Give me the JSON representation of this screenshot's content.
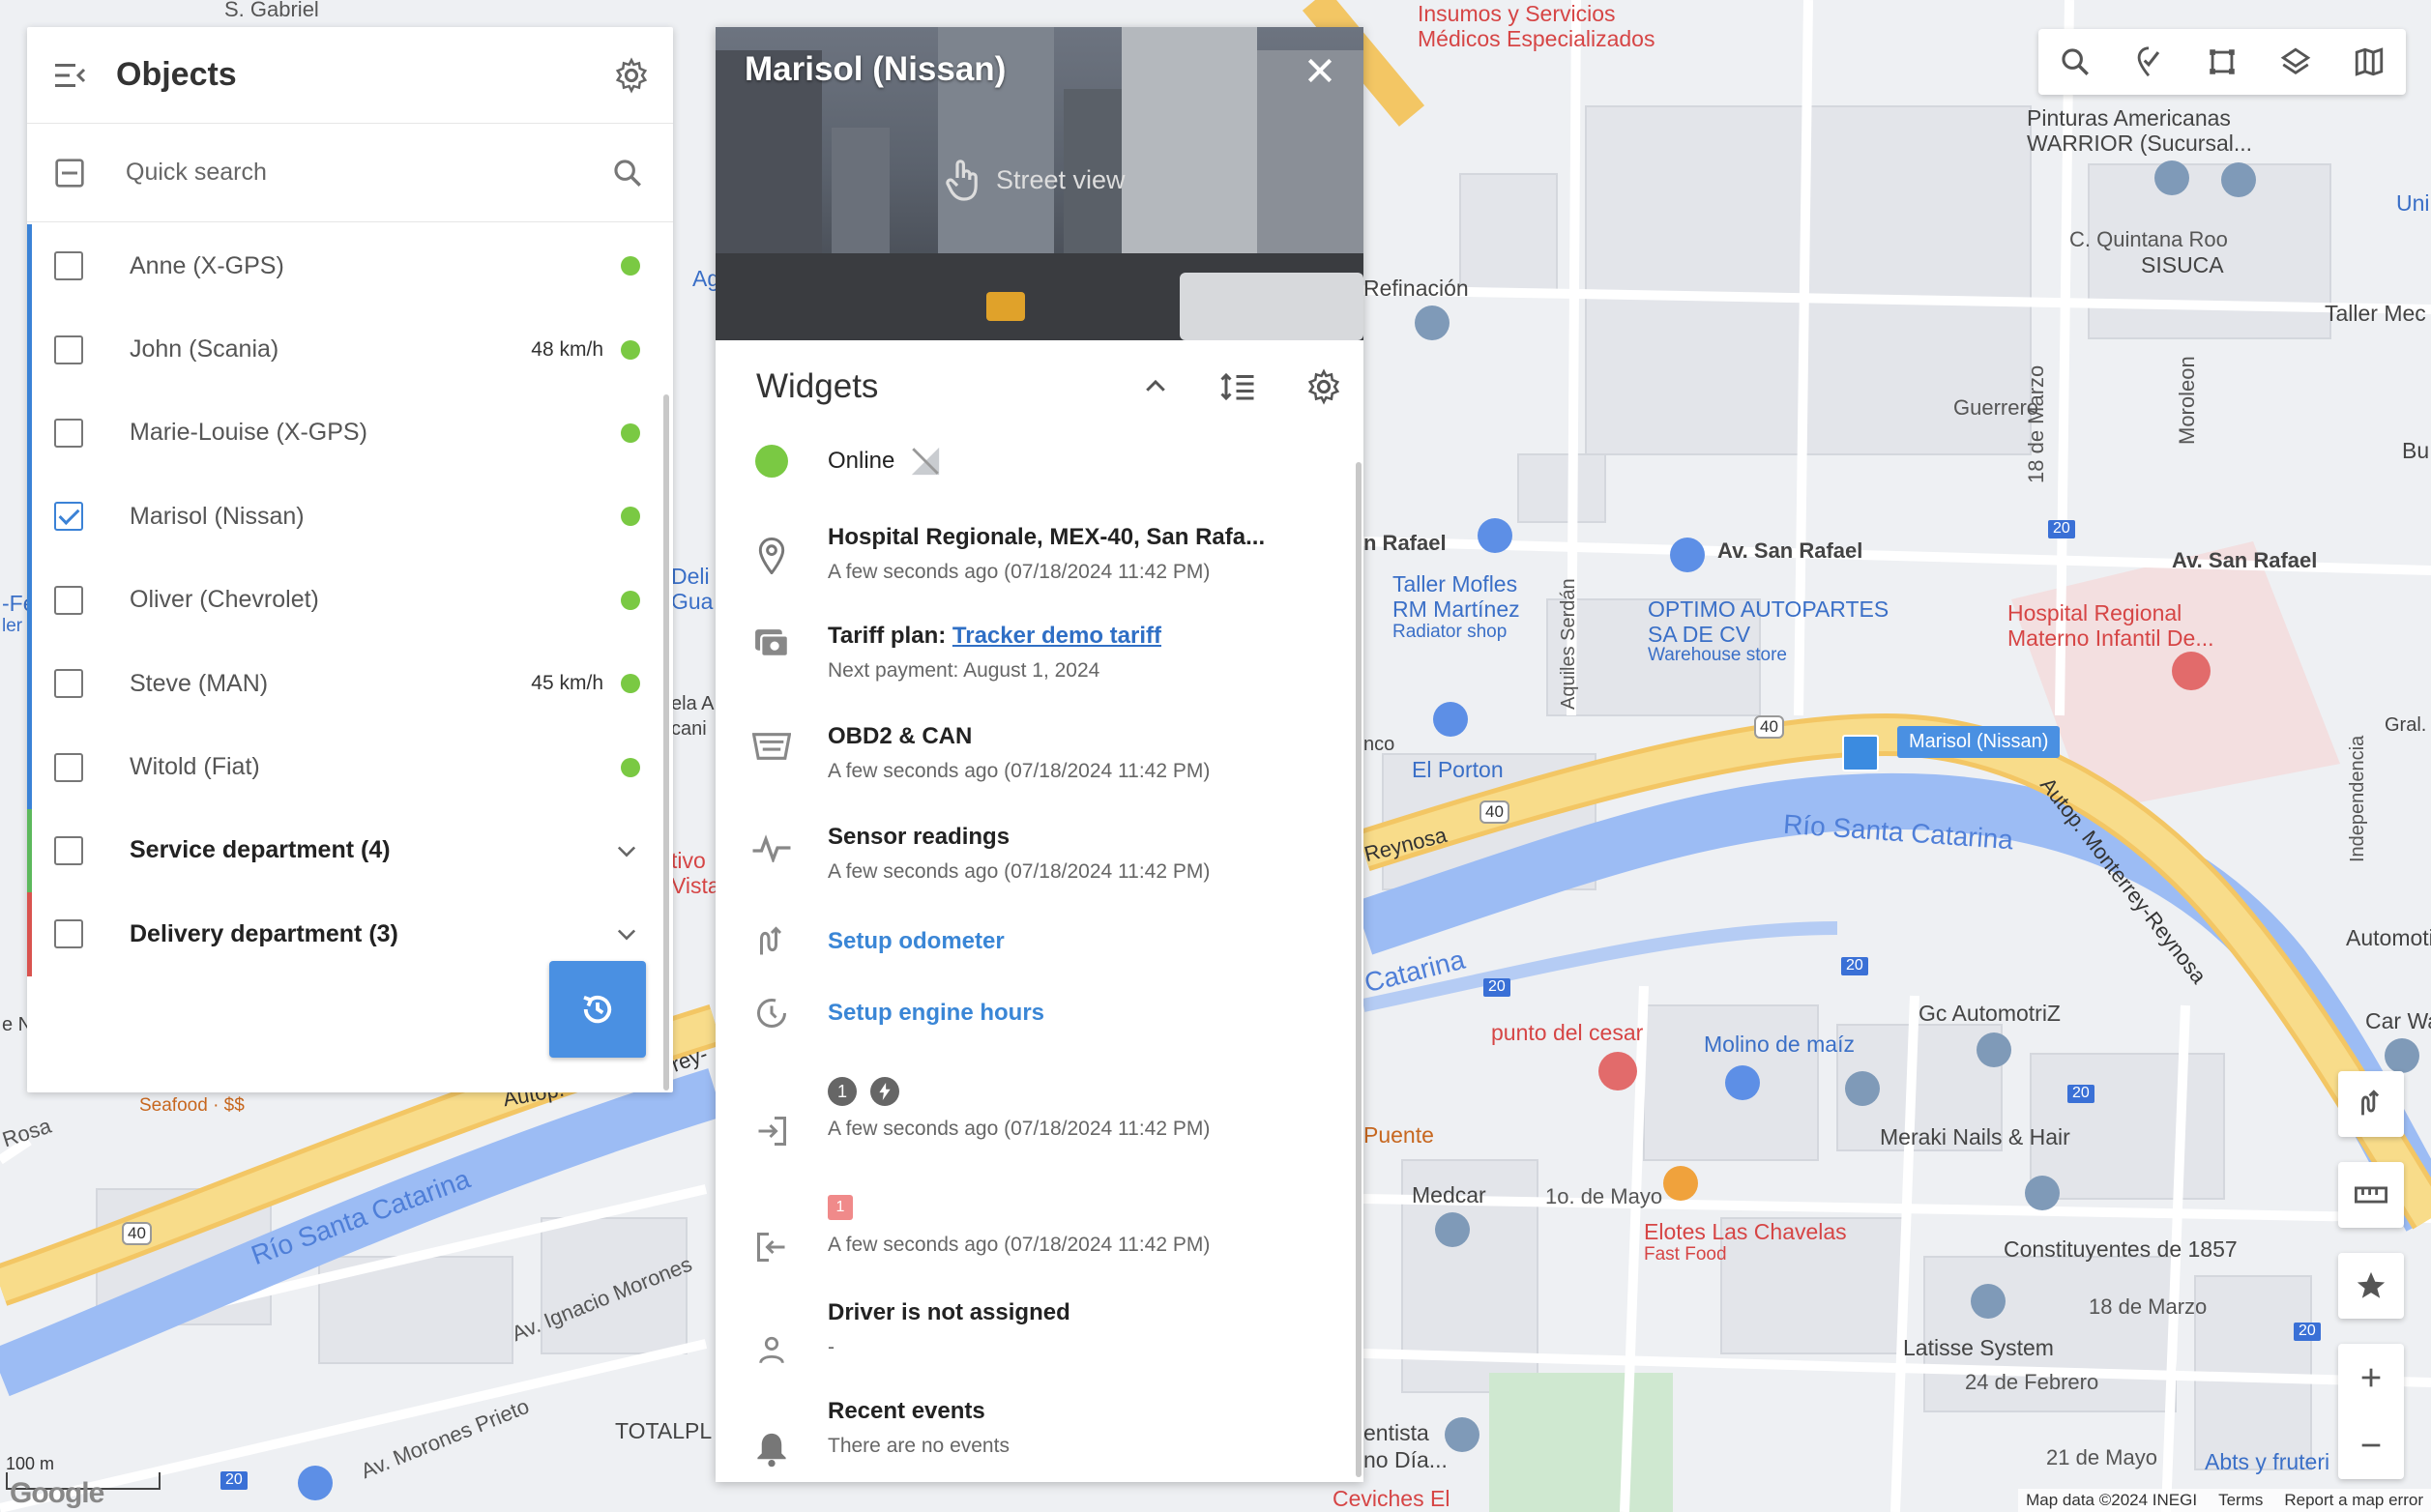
{
  "objects_panel": {
    "title": "Objects",
    "search_placeholder": "Quick search",
    "items": [
      {
        "name": "Anne (X-GPS)",
        "speed": "",
        "checked": false,
        "stripe": "#3b82d6",
        "group": false
      },
      {
        "name": "John (Scania)",
        "speed": "48 km/h",
        "checked": false,
        "stripe": "#3b82d6",
        "group": false
      },
      {
        "name": "Marie-Louise (X-GPS)",
        "speed": "",
        "checked": false,
        "stripe": "#3b82d6",
        "group": false
      },
      {
        "name": "Marisol (Nissan)",
        "speed": "",
        "checked": true,
        "stripe": "#3b82d6",
        "group": false
      },
      {
        "name": "Oliver (Chevrolet)",
        "speed": "",
        "checked": false,
        "stripe": "#3b82d6",
        "group": false
      },
      {
        "name": "Steve (MAN)",
        "speed": "45 km/h",
        "checked": false,
        "stripe": "#3b82d6",
        "group": false
      },
      {
        "name": "Witold (Fiat)",
        "speed": "",
        "checked": false,
        "stripe": "#3b82d6",
        "group": false
      },
      {
        "name": "Service department (4)",
        "speed": "",
        "checked": false,
        "stripe": "#5cb85c",
        "group": true
      },
      {
        "name": "Delivery department (3)",
        "speed": "",
        "checked": false,
        "stripe": "#d9534f",
        "group": true
      }
    ],
    "status_color": "#7ac943"
  },
  "object_card": {
    "title": "Marisol (Nissan)",
    "street_view_label": "Street view",
    "widgets_title": "Widgets",
    "status": "Online",
    "address": "Hospital Regionale, MEX-40, San Rafa...",
    "address_time": "A few seconds ago (07/18/2024 11:42 PM)",
    "tariff_prefix": "Tariff plan: ",
    "tariff_link": "Tracker demo tariff",
    "next_payment": "Next payment: August 1, 2024",
    "obd_title": "OBD2 & CAN",
    "obd_time": "A few seconds ago (07/18/2024 11:42 PM)",
    "sensor_title": "Sensor readings",
    "sensor_time": "A few seconds ago (07/18/2024 11:42 PM)",
    "odometer_link": "Setup odometer",
    "engine_link": "Setup engine hours",
    "inputs_badge_1": "1",
    "inputs_time": "A few seconds ago (07/18/2024 11:42 PM)",
    "outputs_badge": "1",
    "outputs_time": "A few seconds ago (07/18/2024 11:42 PM)",
    "driver_title": "Driver is not assigned",
    "driver_sub": "-",
    "events_title": "Recent events",
    "events_sub": "There are no events"
  },
  "map": {
    "vehicle_label": "Marisol (Nissan)",
    "labels": {
      "s_gabriel": "S. Gabriel",
      "insumos": "Insumos y Servicios",
      "medicos": "Médicos Especializados",
      "pinturas": "Pinturas Americanas",
      "warrior": "WARRIOR (Sucursal...",
      "uni": "Uni",
      "qroo": "C. Quintana Roo",
      "sisuca": "SISUCA",
      "taller_mec": "Taller Mec",
      "refinacion": "Refinación",
      "guerrero": "Guerrero",
      "marzo_18": "18 de Marzo",
      "moroleon": "Moroleon",
      "bu": "Bu",
      "av_san_rafael_1": "Av. San Rafael",
      "av_san_rafael_2": "Av. San Rafael",
      "rafael": "n Rafael",
      "taller_mofles": "Taller Mofles",
      "rm_martinez": "RM Martínez",
      "radiator": "Radiator shop",
      "optimo": "OPTIMO AUTOPARTES",
      "sa_de_cv": "SA DE CV",
      "warehouse": "Warehouse store",
      "aquiles": "Aquiles Serdán",
      "hospital1": "Hospital Regional",
      "hospital2": "Materno Infantil De...",
      "independencia": "Independencia",
      "gral": "Gral.",
      "el_porton": "El Porton",
      "nco": "nco",
      "reynosa": "Reynosa",
      "autop_mty": "Autop. Monterrey-Reynosa",
      "rio_sc_1": "Río Santa Catarina",
      "rio_sc_2": "Río Santa Catarina",
      "carina": "Catarina",
      "automoti": "Automoti",
      "car_wa": "Car Wa",
      "punto_cesar": "punto del cesar",
      "molino": "Molino de maíz",
      "gc_auto": "Gc AutomotriZ",
      "meraki": "Meraki Nails & Hair",
      "puente": "Puente",
      "medcar": "Medcar",
      "mayo_1": "1o. de Mayo",
      "elotes": "Elotes Las Chavelas",
      "fast_food": "Fast Food",
      "constituyentes": "Constituyentes de 1857",
      "marzo_18b": "18 de Marzo",
      "latisse": "Latisse System",
      "febrero_24": "24 de Febrero",
      "mayo_21": "21 de Mayo",
      "abts": "Abts y fruteri",
      "ventista": "entista",
      "nio_dia": "no Día...",
      "ceviches": "Ceviches El",
      "totalpl": "TOTALPL",
      "av_morones": "Av. Ignacio Morones",
      "av_morones_prieto": "Av. Morones Prieto",
      "rosa": "Rosa",
      "seafood": "Seafood · $$",
      "ag": "Ag",
      "deli": "Deli",
      "gua": "Gua",
      "ela": "ela A",
      "cani": "cani",
      "tivo": "tivo",
      "vista": "Vista",
      "n_fe": "-Fe",
      "ler": "ler",
      "e_n": "e N",
      "autop": "Autop.",
      "arina": "arina",
      "rey": "rey-",
      "sh_40a": "40",
      "sh_40b": "40",
      "sh_40c": "40",
      "sh_20a": "20",
      "sh_20b": "20",
      "sh_20c": "20",
      "sh_20d": "20",
      "sh_20e": "20",
      "sh_20f": "20"
    },
    "scale": "100 m",
    "google": "Google",
    "attribution": {
      "data": "Map data ©2024 INEGI",
      "terms": "Terms",
      "report": "Report a map error"
    }
  },
  "colors": {
    "accent": "#4a90e2",
    "online": "#7ac943",
    "road_major": "#f7d27a",
    "river": "#9cbcf4"
  }
}
